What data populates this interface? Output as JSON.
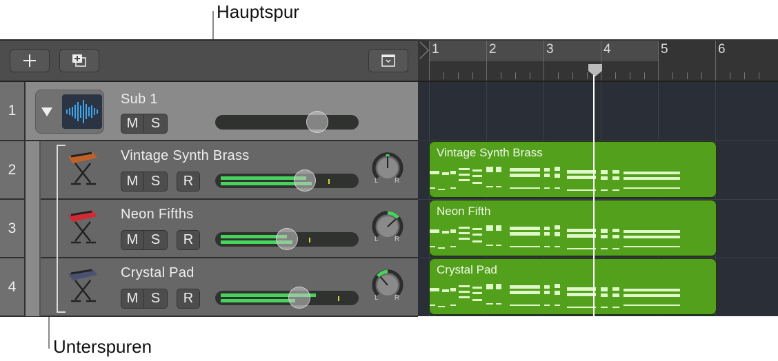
{
  "callouts": {
    "main_track": "Hauptspur",
    "sub_tracks": "Unterspuren"
  },
  "toolbar": {
    "add_track_icon": "plus-icon",
    "duplicate_track_icon": "duplicate-track-icon",
    "collapse_icon": "chevron-down-box-icon"
  },
  "ruler": {
    "bars": [
      "1",
      "2",
      "3",
      "4",
      "5",
      "6"
    ],
    "playhead_position_bars": 3.8,
    "cycle_range": [
      1,
      5
    ]
  },
  "tracks": [
    {
      "number": "1",
      "name": "Sub 1",
      "type": "summing-stack",
      "icon": "audio-waveform-icon",
      "expanded": true,
      "buttons": [
        "M",
        "S"
      ],
      "volume": 0.72
    },
    {
      "number": "2",
      "name": "Vintage Synth Brass",
      "icon": "vintage-synth-icon",
      "buttons": [
        "M",
        "S",
        "R"
      ],
      "volume": 0.65,
      "meter_levels": [
        0.62,
        0.66
      ],
      "pan": 0.0,
      "pan_label_l": "L",
      "pan_label_r": "R",
      "region": "Vintage Synth Brass"
    },
    {
      "number": "3",
      "name": "Neon Fifths",
      "icon": "red-keyboard-icon",
      "buttons": [
        "M",
        "S",
        "R"
      ],
      "volume": 0.5,
      "meter_levels": [
        0.48,
        0.52
      ],
      "pan": 0.35,
      "pan_label_l": "L",
      "pan_label_r": "R",
      "region": "Neon Fifth"
    },
    {
      "number": "4",
      "name": "Crystal Pad",
      "icon": "workstation-keyboard-icon",
      "buttons": [
        "M",
        "S",
        "R"
      ],
      "volume": 0.6,
      "meter_levels": [
        0.69,
        0.54
      ],
      "pan": -0.3,
      "pan_label_l": "L",
      "pan_label_r": "R",
      "region": "Crystal Pad"
    }
  ],
  "colors": {
    "region_green": "#52a01c",
    "meter_green": "#47d35c",
    "waveform_blue": "#3ea6ee"
  }
}
